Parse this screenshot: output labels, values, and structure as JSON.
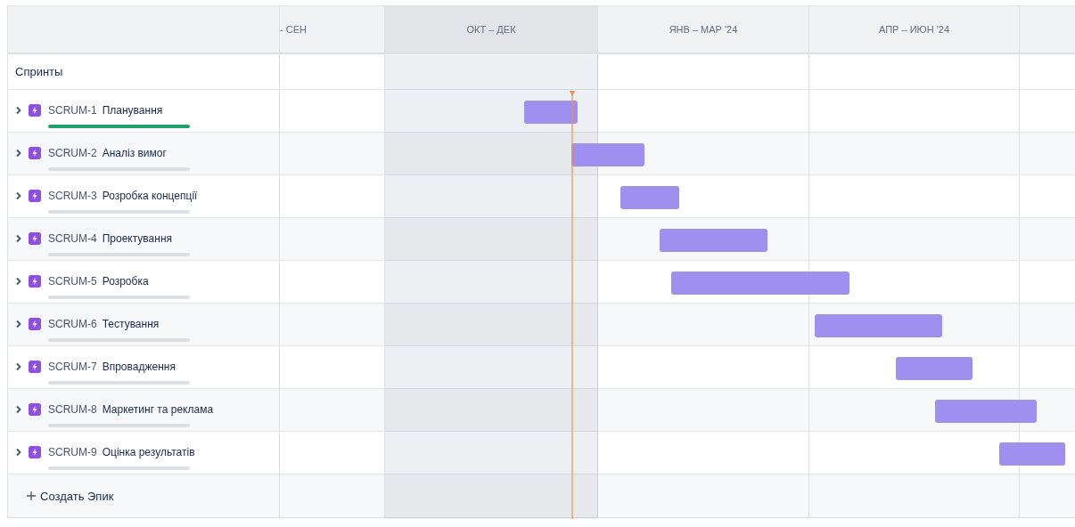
{
  "timeline": {
    "columns": [
      {
        "label": "- СЕН",
        "current": false
      },
      {
        "label": "ОКТ – ДЕК",
        "current": true
      },
      {
        "label": "ЯНВ – МАР '24",
        "current": false
      },
      {
        "label": "АПР – ИЮН '24",
        "current": false
      }
    ]
  },
  "sprints_row": {
    "label": "Спринты"
  },
  "epics": [
    {
      "key": "SCRUM-1",
      "title": "Планування",
      "level": 1
    },
    {
      "key": "SCRUM-2",
      "title": "Аналіз вимог",
      "level": 0
    },
    {
      "key": "SCRUM-3",
      "title": "Розробка концепції",
      "level": 0
    },
    {
      "key": "SCRUM-4",
      "title": "Проектування",
      "level": 0
    },
    {
      "key": "SCRUM-5",
      "title": "Розробка",
      "level": 0
    },
    {
      "key": "SCRUM-6",
      "title": "Тестування",
      "level": 0
    },
    {
      "key": "SCRUM-7",
      "title": "Впровадження",
      "level": 0
    },
    {
      "key": "SCRUM-8",
      "title": "Маркетинг та реклама",
      "level": 0
    },
    {
      "key": "SCRUM-9",
      "title": "Оцінка результатів",
      "level": 0
    }
  ],
  "create_button": {
    "label": "Создать Эпик"
  }
}
